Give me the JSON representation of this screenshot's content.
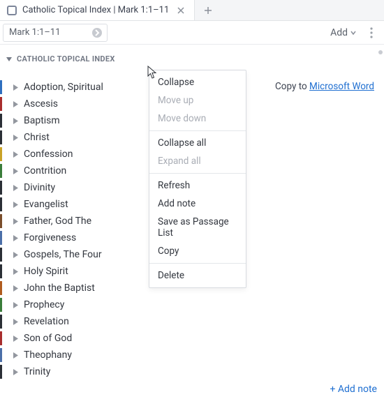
{
  "tab": {
    "title": "Catholic Topical Index | Mark 1:1–11"
  },
  "toolbar": {
    "reference": "Mark 1:1–11",
    "add_label": "Add"
  },
  "section": {
    "header": "CATHOLIC TOPICAL INDEX"
  },
  "copy_line": {
    "prefix": "Copy to ",
    "link": "Microsoft Word"
  },
  "topics": [
    "Adoption, Spiritual",
    "Ascesis",
    "Baptism",
    "Christ",
    "Confession",
    "Contrition",
    "Divinity",
    "Evangelist",
    "Father, God The",
    "Forgiveness",
    "Gospels, The Four",
    "Holy Spirit",
    "John the Baptist",
    "Prophecy",
    "Revelation",
    "Son of God",
    "Theophany",
    "Trinity"
  ],
  "context_menu": {
    "collapse": "Collapse",
    "move_up": "Move up",
    "move_down": "Move down",
    "collapse_all": "Collapse all",
    "expand_all": "Expand all",
    "refresh": "Refresh",
    "add_note": "Add note",
    "save_passage": "Save as Passage List",
    "copy": "Copy",
    "delete": "Delete"
  },
  "footer": {
    "add_note": "+ Add note"
  },
  "stripe_colors": [
    "#2e6fbf",
    "#a82d2d",
    "#2b2f36",
    "#2b2f36",
    "#c9a227",
    "#3a7d3a",
    "#2b2f36",
    "#2b2f36",
    "#7a4d2b",
    "#4b6fa8",
    "#2b2f36",
    "#2b2f36",
    "#b05c1e",
    "#3a7d3a",
    "#2b2f36",
    "#a82d2d",
    "#4b6fa8",
    "#2b2f36"
  ]
}
